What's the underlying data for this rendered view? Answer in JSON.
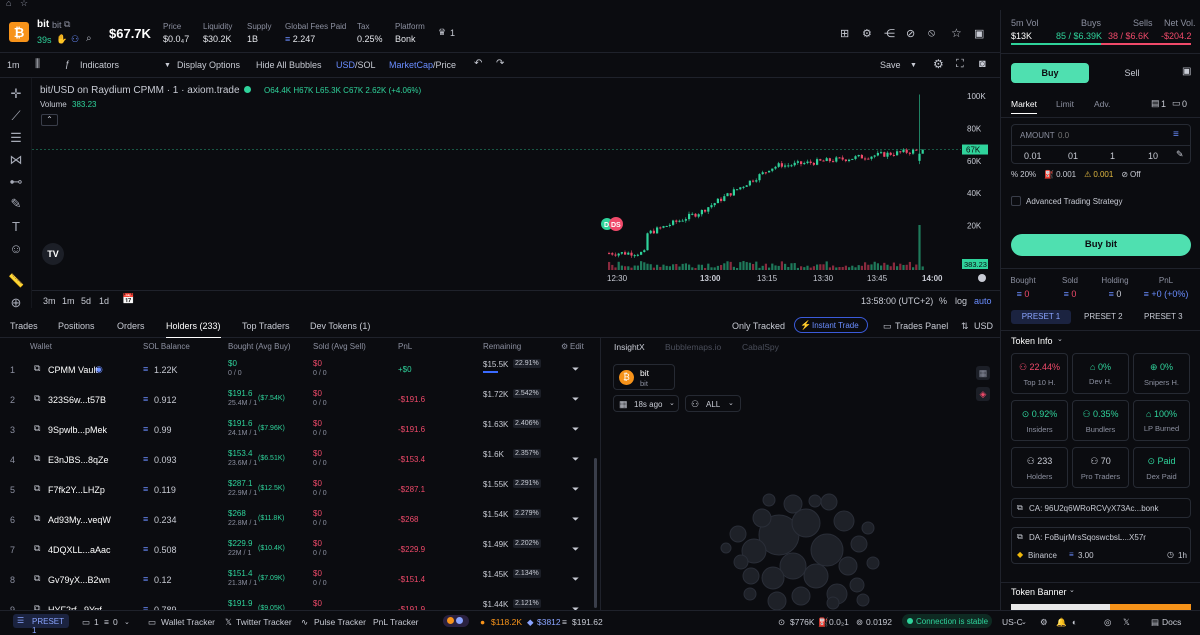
{
  "header": {
    "token_name": "bit",
    "token_ticker": "bit",
    "age": "39s",
    "price_big": "$67.7K",
    "stats": [
      {
        "label": "Price",
        "value": "$0.0₄7"
      },
      {
        "label": "Liquidity",
        "value": "$30.2K"
      },
      {
        "label": "Supply",
        "value": "1B"
      },
      {
        "label": "Global Fees Paid",
        "value": "2.247"
      },
      {
        "label": "Tax",
        "value": "0.25%"
      },
      {
        "label": "Platform",
        "value": "Bonk"
      }
    ],
    "crown_count": "1"
  },
  "toolbar": {
    "interval": "1m",
    "indicators": "Indicators",
    "display_options": "Display Options",
    "hide_bubbles": "Hide All Bubbles",
    "usd": "USD",
    "sol": "SOL",
    "mcap": "MarketCap",
    "price": "Price",
    "save": "Save"
  },
  "chart": {
    "title": "bit/USD on Raydium CPMM · 1 · axiom.trade",
    "ohlc": "O64.4K H67K L65.3K C67K 2.62K (+4.06%)",
    "volume_label": "Volume",
    "volume_value": "383.23",
    "current_label": "67K",
    "volume_tag": "383.23",
    "time_readout": "13:58:00 (UTC+2)",
    "pct": "%",
    "log": "log",
    "auto": "auto",
    "ranges": [
      "3m",
      "1m",
      "5d",
      "1d"
    ],
    "markers": [
      "D",
      "DS"
    ]
  },
  "chart_data": {
    "type": "candlestick",
    "y_ticks": [
      "100K",
      "80K",
      "60K",
      "40K",
      "20K"
    ],
    "x_ticks": [
      "12:30",
      "13:00",
      "13:15",
      "13:30",
      "13:45",
      "14:00"
    ],
    "ylim": [
      0,
      105000
    ]
  },
  "tabs": {
    "items": [
      "Trades",
      "Positions",
      "Orders",
      "Holders (233)",
      "Top Traders",
      "Dev Tokens (1)"
    ],
    "only_tracked": "Only Tracked",
    "instant_trade": "Instant Trade",
    "trades_panel": "Trades Panel",
    "usd": "USD"
  },
  "holders": {
    "headers": [
      "Wallet",
      "SOL Balance",
      "Bought (Avg Buy)",
      "Sold (Avg Sell)",
      "PnL",
      "Remaining",
      "Edit"
    ],
    "rows": [
      {
        "n": "1",
        "wallet": "CPMM Vault",
        "sol": "1.22K",
        "bought": "$0",
        "bought_sub": "0 / 0",
        "avg": "",
        "sold": "$0",
        "sold_sub": "0 / 0",
        "pnl": "+$0",
        "rem": "$15.5K",
        "pct": "22.91%",
        "barw": 22
      },
      {
        "n": "2",
        "wallet": "323S6w...t57B",
        "sol": "0.912",
        "bought": "$191.6",
        "bought_sub": "25.4M / 1",
        "avg": "($7.54K)",
        "sold": "$0",
        "sold_sub": "0 / 0",
        "pnl": "-$191.6",
        "rem": "$1.72K",
        "pct": "2.542%",
        "barw": 0
      },
      {
        "n": "3",
        "wallet": "9Spwlb...pMek",
        "sol": "0.99",
        "bought": "$191.6",
        "bought_sub": "24.1M / 1",
        "avg": "($7.96K)",
        "sold": "$0",
        "sold_sub": "0 / 0",
        "pnl": "-$191.6",
        "rem": "$1.63K",
        "pct": "2.406%",
        "barw": 0
      },
      {
        "n": "4",
        "wallet": "E3nJBS...8qZe",
        "sol": "0.093",
        "bought": "$153.4",
        "bought_sub": "23.6M / 1",
        "avg": "($6.51K)",
        "sold": "$0",
        "sold_sub": "0 / 0",
        "pnl": "-$153.4",
        "rem": "$1.6K",
        "pct": "2.357%",
        "barw": 0
      },
      {
        "n": "5",
        "wallet": "F7fk2Y...LHZp",
        "sol": "0.119",
        "bought": "$287.1",
        "bought_sub": "22.9M / 1",
        "avg": "($12.5K)",
        "sold": "$0",
        "sold_sub": "0 / 0",
        "pnl": "-$287.1",
        "rem": "$1.55K",
        "pct": "2.291%",
        "barw": 0
      },
      {
        "n": "6",
        "wallet": "Ad93My...veqW",
        "sol": "0.234",
        "bought": "$268",
        "bought_sub": "22.8M / 1",
        "avg": "($11.8K)",
        "sold": "$0",
        "sold_sub": "0 / 0",
        "pnl": "-$268",
        "rem": "$1.54K",
        "pct": "2.279%",
        "barw": 0
      },
      {
        "n": "7",
        "wallet": "4DQXLL...aAac",
        "sol": "0.508",
        "bought": "$229.9",
        "bought_sub": "22M / 1",
        "avg": "($10.4K)",
        "sold": "$0",
        "sold_sub": "0 / 0",
        "pnl": "-$229.9",
        "rem": "$1.49K",
        "pct": "2.202%",
        "barw": 0
      },
      {
        "n": "8",
        "wallet": "Gv79yX...B2wn",
        "sol": "0.12",
        "bought": "$151.4",
        "bought_sub": "21.3M / 1",
        "avg": "($7.09K)",
        "sold": "$0",
        "sold_sub": "0 / 0",
        "pnl": "-$151.4",
        "rem": "$1.45K",
        "pct": "2.134%",
        "barw": 0
      },
      {
        "n": "9",
        "wallet": "HYF2rf...9Yqf",
        "sol": "0.789",
        "bought": "$191.9",
        "bought_sub": "",
        "avg": "($9.05K)",
        "sold": "$0",
        "sold_sub": "",
        "pnl": "-$191.9",
        "rem": "$1.44K",
        "pct": "2.121%",
        "barw": 0
      }
    ]
  },
  "insight": {
    "tabs": [
      "InsightX",
      "Bubblemaps.io",
      "CabalSpy"
    ],
    "token_name": "bit",
    "token_ticker": "bit",
    "time": "18s ago",
    "filter": "ALL"
  },
  "right": {
    "vol_label": "5m Vol",
    "vol_value": "$13K",
    "buys_label": "Buys",
    "buys_value": "85 / $6.39K",
    "sells_label": "Sells",
    "sells_value": "38 / $6.6K",
    "net_label": "Net Vol.",
    "net_value": "-$204.2",
    "buy_tab": "Buy",
    "sell_tab": "Sell",
    "order_tabs": [
      "Market",
      "Limit",
      "Adv."
    ],
    "preset_count": "1",
    "zero": "0",
    "amount_label": "AMOUNT",
    "amount_placeholder": "0.0",
    "quick": [
      "0.01",
      "01",
      "1",
      "10"
    ],
    "slippage": "20%",
    "priority": "0.001",
    "bribe": "0.001",
    "mev": "Off",
    "advanced": "Advanced Trading Strategy",
    "buy_button": "Buy bit",
    "pos": [
      {
        "l": "Bought",
        "v": "0"
      },
      {
        "l": "Sold",
        "v": "0"
      },
      {
        "l": "Holding",
        "v": "0"
      },
      {
        "l": "PnL",
        "v": "+0 (+0%)"
      }
    ],
    "presets": [
      "PRESET 1",
      "PRESET 2",
      "PRESET 3"
    ],
    "token_info": "Token Info",
    "info": [
      {
        "v": "22.44%",
        "l": "Top 10 H."
      },
      {
        "v": "0%",
        "l": "Dev H."
      },
      {
        "v": "0%",
        "l": "Snipers H."
      },
      {
        "v": "0.92%",
        "l": "Insiders"
      },
      {
        "v": "0.35%",
        "l": "Bundlers"
      },
      {
        "v": "100%",
        "l": "LP Burned"
      },
      {
        "v": "233",
        "l": "Holders"
      },
      {
        "v": "70",
        "l": "Pro Traders"
      },
      {
        "v": "Paid",
        "l": "Dex Paid"
      }
    ],
    "ca": "CA: 96U2q6WRoRCVyX73Ac...bonk",
    "da": "DA: FoBujrMrsSqoswcbsL...X57r",
    "exchange": "Binance",
    "exchange_value": "3.00",
    "age": "1h",
    "token_banner": "Token Banner"
  },
  "status": {
    "preset": "PRESET 1",
    "count1": "1",
    "count2": "0",
    "wallet_tracker": "Wallet Tracker",
    "twitter_tracker": "Twitter Tracker",
    "pulse_tracker": "Pulse Tracker",
    "pnl_tracker": "PnL Tracker",
    "btc": "$118.2K",
    "eth": "$3812",
    "sol": "$191.62",
    "mcap": "$776K",
    "gas": "0.0₂1",
    "sol2": "0.0192",
    "connection": "Connection is stable",
    "region": "US-C",
    "docs": "Docs"
  },
  "colors": {
    "green": "#2fd39b",
    "red": "#f04a6a",
    "accent": "#4fe0b0",
    "blue": "#3b6bff"
  }
}
